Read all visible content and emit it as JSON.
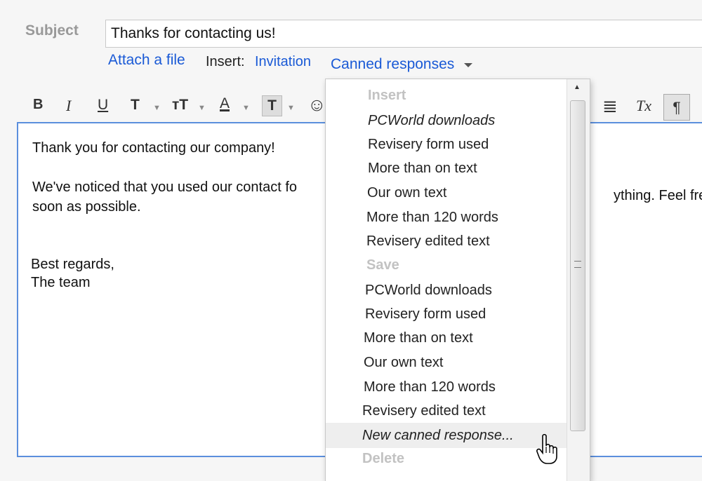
{
  "subject": {
    "label": "Subject",
    "value": "Thanks for contacting us!"
  },
  "links": {
    "attach": "Attach a file",
    "insert_label": "Insert:",
    "invitation": "Invitation",
    "canned": "Canned responses"
  },
  "toolbar": {
    "bold": "B",
    "italic": "I",
    "underline": "U",
    "font": "T",
    "size": "тT",
    "text_color": "A",
    "highlight": "T",
    "emoji": "☺",
    "align": "≣",
    "clear": "Tx",
    "rtl": "¶"
  },
  "body": {
    "line1": "Thank you for contacting our company!",
    "line2a": "We've noticed that you used our contact fo",
    "line2b": "ything. Feel free",
    "line3": "soon as possible.",
    "line4": "Best regards,",
    "line5": "The team"
  },
  "menu": {
    "insert_header": "Insert",
    "insert_items": [
      "PCWorld downloads",
      "Revisery form used",
      "More than on text",
      "Our own text",
      "More than 120 words",
      "Revisery edited text"
    ],
    "save_header": "Save",
    "save_items": [
      "PCWorld downloads",
      "Revisery form used",
      "More than on text",
      "Our own text",
      "More than 120 words",
      "Revisery edited text"
    ],
    "new_response": "New canned response...",
    "delete_header": "Delete"
  },
  "colors": {
    "link": "#1a5ad6",
    "editor_border": "#5b8fdd",
    "disabled": "#c2c2c2"
  },
  "icons": [
    "chevron-down-icon",
    "emoji-icon",
    "align-icon",
    "clear-format-icon",
    "paragraph-icon",
    "hand-cursor-icon"
  ]
}
